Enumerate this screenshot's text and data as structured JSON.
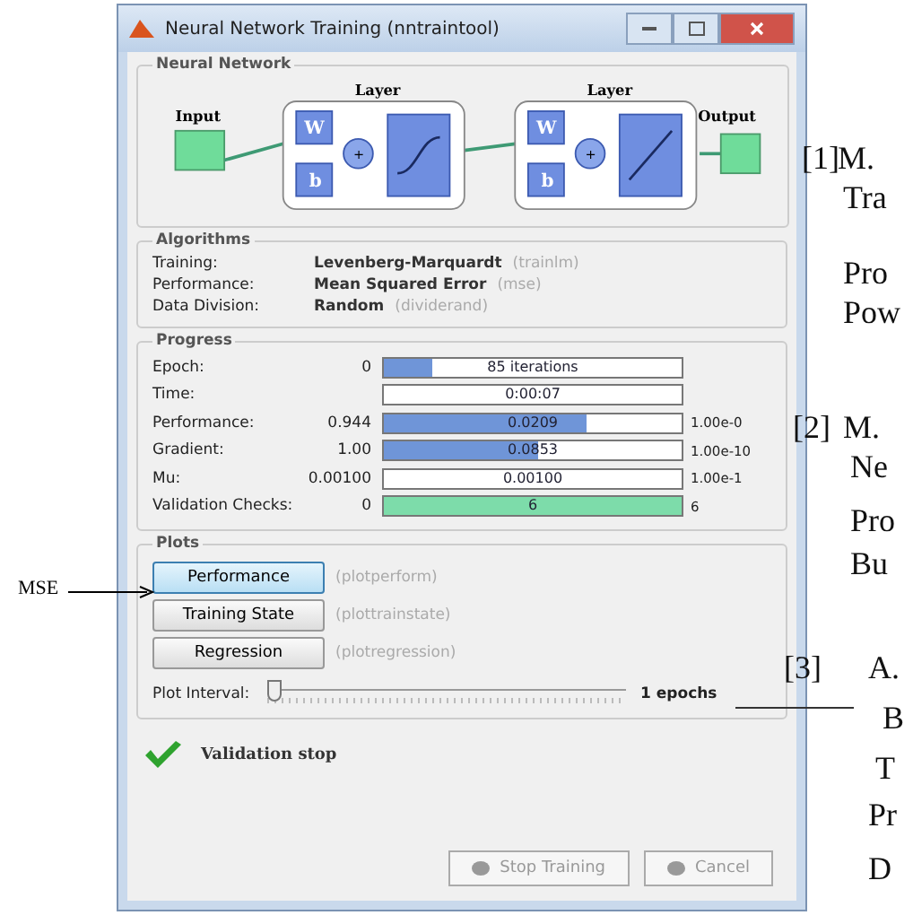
{
  "window": {
    "title": "Neural Network Training (nntraintool)"
  },
  "network": {
    "title": "Neural Network",
    "input": "Input",
    "output": "Output",
    "layers": [
      {
        "title": "Layer",
        "weight": "W",
        "bias": "b",
        "sum": "+",
        "kind": "sigmoid"
      },
      {
        "title": "Layer",
        "weight": "W",
        "bias": "b",
        "sum": "+",
        "kind": "linear"
      }
    ]
  },
  "algorithms": {
    "title": "Algorithms",
    "rows": [
      {
        "label": "Training:",
        "value": "Levenberg-Marquardt",
        "function": "(trainlm)"
      },
      {
        "label": "Performance:",
        "value": "Mean Squared Error",
        "function": "(mse)"
      },
      {
        "label": "Data Division:",
        "value": "Random",
        "function": "(dividerand)"
      }
    ]
  },
  "progress": {
    "title": "Progress",
    "rows": [
      {
        "label": "Epoch:",
        "start": "0",
        "reading": "85 iterations",
        "level": 0.16,
        "color": "#6f95d8"
      },
      {
        "label": "Time:",
        "reading": "0:00:07"
      },
      {
        "label": "Performance:",
        "start": "0.944",
        "reading": "0.0209",
        "level": 0.68,
        "end": "1.00e-0",
        "color": "#6f95d8"
      },
      {
        "label": "Gradient:",
        "start": "1.00",
        "reading": "0.0853",
        "level": 0.52,
        "end": "1.00e-10",
        "color": "#6f95d8"
      },
      {
        "label": "Mu:",
        "start": "0.00100",
        "reading": "0.00100",
        "end": "1.00e-1"
      },
      {
        "label": "Validation Checks:",
        "start": "0",
        "reading": "6",
        "level": 1,
        "end": "6",
        "color": "#7ddcaa"
      }
    ]
  },
  "plots": {
    "title": "Plots",
    "buttons": [
      {
        "label": "Performance",
        "function": "(plotperform)",
        "selected": true
      },
      {
        "label": "Training State",
        "function": "(plottrainstate)",
        "selected": false
      },
      {
        "label": "Regression",
        "function": "(plotregression)",
        "selected": false
      }
    ],
    "interval": {
      "label": "Plot Interval:",
      "level": 0,
      "reading": "1 epochs"
    }
  },
  "status": {
    "text": "Validation stop"
  },
  "buttons": [
    {
      "label": "Stop Training",
      "disabled": true
    },
    {
      "label": "Cancel",
      "disabled": true
    }
  ],
  "annotation": {
    "label": "MSE"
  },
  "document_fragments": [
    "[1]",
    "M.",
    "Tra",
    "Pro",
    "Pow",
    "[2]",
    "M.",
    "Ne",
    "Pro",
    "Bu",
    "[3]",
    "A.",
    "B",
    "T",
    "Pr",
    "D"
  ]
}
